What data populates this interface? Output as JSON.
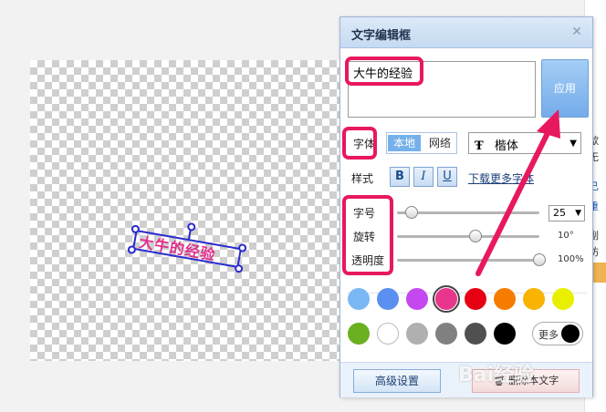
{
  "canvas": {
    "text_object": "大牛的经验"
  },
  "side_fragments": [
    "歙",
    "无",
    "已",
    "重",
    "副",
    "坊"
  ],
  "dialog": {
    "title": "文字编辑框",
    "close_icon": "close-icon",
    "text_value": "大牛的经验",
    "apply_label": "应用",
    "font_label": "字体",
    "source_local": "本地",
    "source_network": "网络",
    "font_icon": "font-type-icon",
    "font_name": "楷体",
    "style_label": "样式",
    "bold": "B",
    "italic": "I",
    "underline": "U",
    "download_link": "下载更多字体",
    "size_label": "字号",
    "size_value": "25",
    "rotate_label": "旋转",
    "rotate_value": "10°",
    "opacity_label": "透明度",
    "opacity_value": "100%",
    "sliders": {
      "size_fraction": 0.1,
      "rotate_fraction": 0.55,
      "opacity_fraction": 1.0
    },
    "colors_row1": [
      "#7ab8f5",
      "#5b8ff0",
      "#c448f0",
      "#e8368c",
      "#e60012",
      "#f57c00",
      "#f8b400",
      "#e8f000"
    ],
    "colors_row2": [
      "#6ab020",
      "#ffffff",
      "#b0b0b0",
      "#808080",
      "#505050",
      "#000000"
    ],
    "selected_color": "#e8368c",
    "more_label": "更多",
    "more_color": "#000000",
    "advanced_label": "高级设置",
    "delete_label": "删除本文字",
    "delete_icon": "trash-icon"
  },
  "watermark": "Bai经验",
  "annotation_color": "#e8185f"
}
